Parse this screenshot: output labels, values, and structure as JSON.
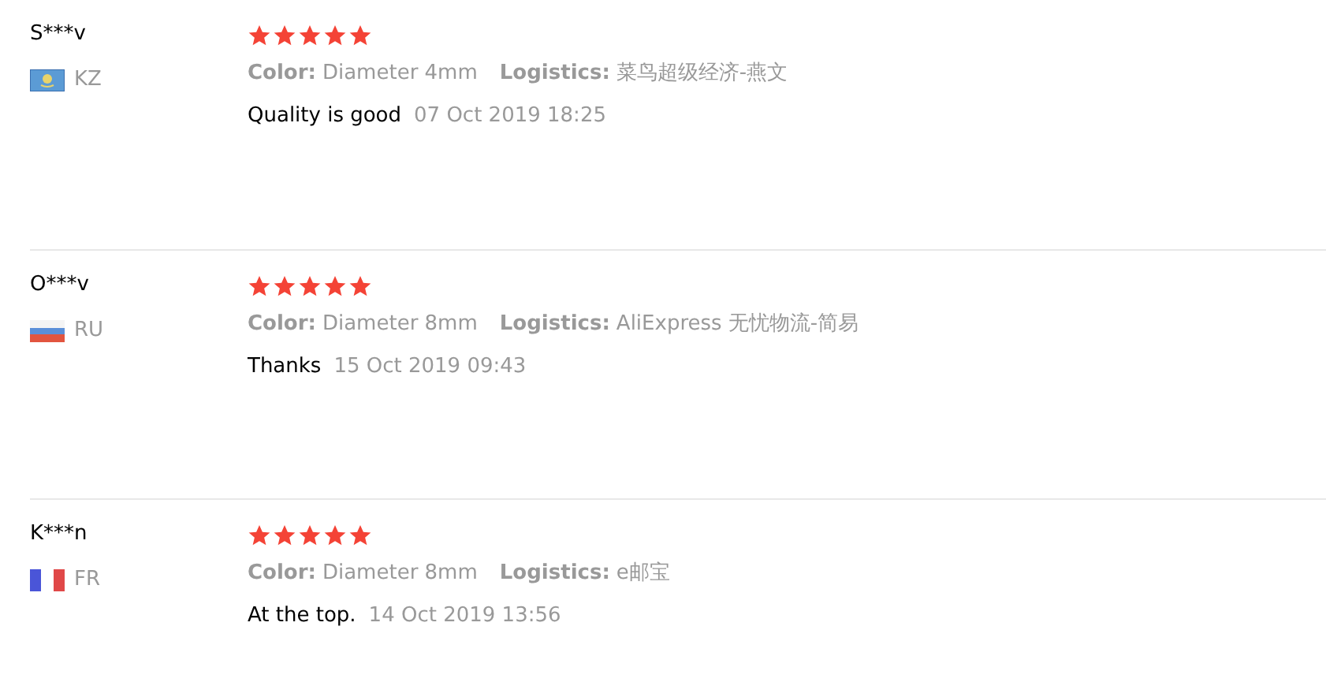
{
  "reviews": [
    {
      "user": "S***v",
      "flag": {
        "kind": "kz"
      },
      "country": "KZ",
      "stars": 5,
      "attributes": [
        {
          "label": "Color:",
          "value": "Diameter 4mm"
        },
        {
          "label": "Logistics:",
          "value": "菜鸟超级经济-燕文"
        }
      ],
      "comment": "Quality is good",
      "date": "07 Oct 2019 18:25"
    },
    {
      "user": "O***v",
      "flag": {
        "kind": "ru"
      },
      "country": "RU",
      "stars": 5,
      "attributes": [
        {
          "label": "Color:",
          "value": "Diameter 8mm"
        },
        {
          "label": "Logistics:",
          "value": "AliExpress 无忧物流-简易"
        }
      ],
      "comment": "Thanks",
      "date": "15 Oct 2019 09:43"
    },
    {
      "user": "K***n",
      "flag": {
        "kind": "fr"
      },
      "country": "FR",
      "stars": 5,
      "attributes": [
        {
          "label": "Color:",
          "value": "Diameter 8mm"
        },
        {
          "label": "Logistics:",
          "value": "e邮宝"
        }
      ],
      "comment": "At the top.",
      "date": "14 Oct 2019 13:56"
    }
  ]
}
